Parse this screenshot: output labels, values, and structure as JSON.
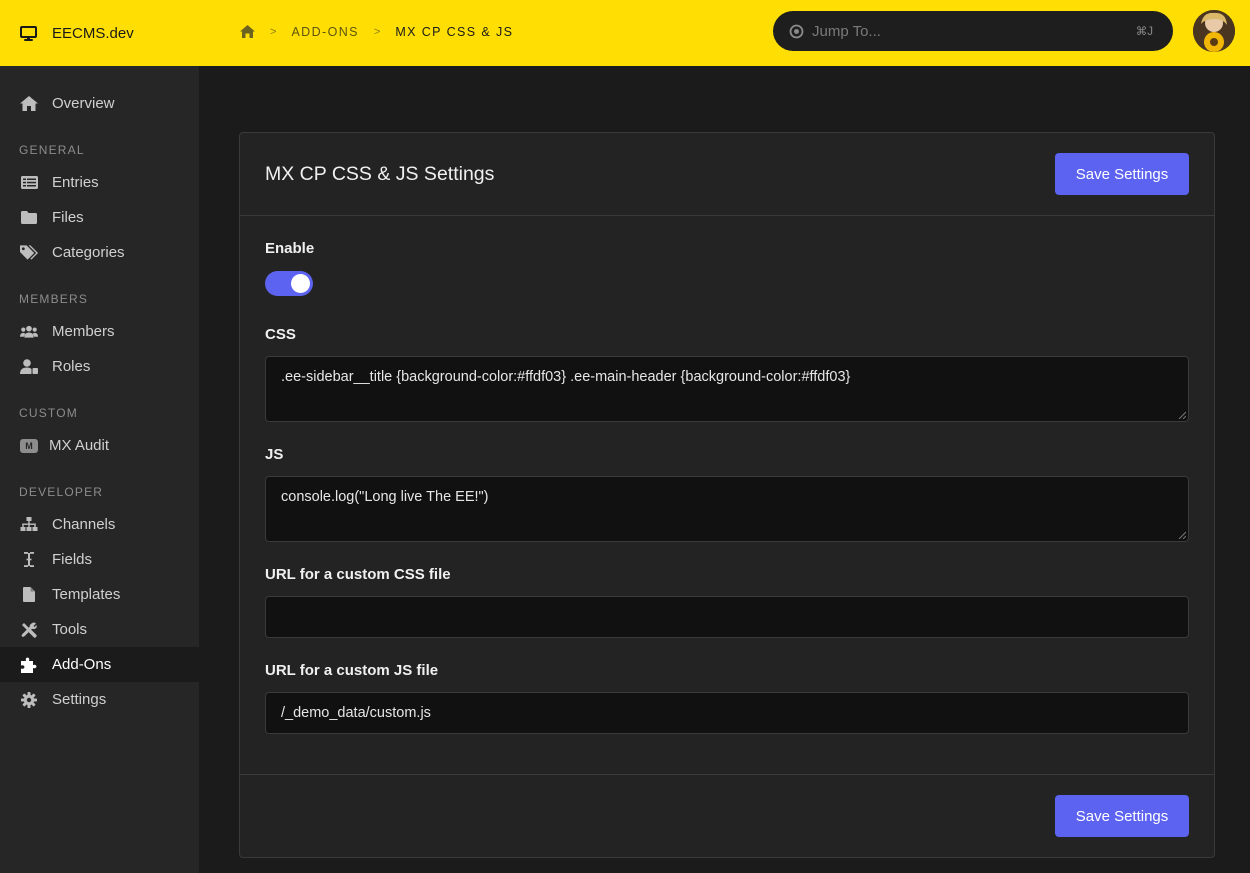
{
  "brand": {
    "name": "EECMS.dev",
    "icon": "monitor-icon"
  },
  "breadcrumb": {
    "home_icon": "home-icon",
    "separator": ">",
    "items": [
      "ADD-ONS",
      "MX CP CSS & JS"
    ]
  },
  "jump": {
    "placeholder": "Jump To...",
    "shortcut": "⌘J"
  },
  "sidebar": {
    "overview": "Overview",
    "sections": [
      {
        "heading": "GENERAL",
        "items": [
          "Entries",
          "Files",
          "Categories"
        ]
      },
      {
        "heading": "MEMBERS",
        "items": [
          "Members",
          "Roles"
        ]
      },
      {
        "heading": "CUSTOM",
        "items": [
          "MX Audit"
        ],
        "badge": "M"
      },
      {
        "heading": "DEVELOPER",
        "items": [
          "Channels",
          "Fields",
          "Templates",
          "Tools",
          "Add-Ons",
          "Settings"
        ]
      }
    ],
    "active": "Add-Ons"
  },
  "panel": {
    "title": "MX CP CSS & JS Settings",
    "save_label": "Save Settings",
    "enable_label": "Enable",
    "enable_on": true,
    "css_label": "CSS",
    "css_value": ".ee-sidebar__title {background-color:#ffdf03} .ee-main-header {background-color:#ffdf03}",
    "js_label": "JS",
    "js_value": "console.log(\"Long live The EE!\")",
    "css_url_label": "URL for a custom CSS file",
    "css_url_value": "",
    "js_url_label": "URL for a custom JS file",
    "js_url_value": "/_demo_data/custom.js"
  },
  "colors": {
    "topbar": "#ffdf03",
    "accent": "#5d63f1",
    "sidebar": "#262626",
    "background": "#1b1b1b"
  }
}
